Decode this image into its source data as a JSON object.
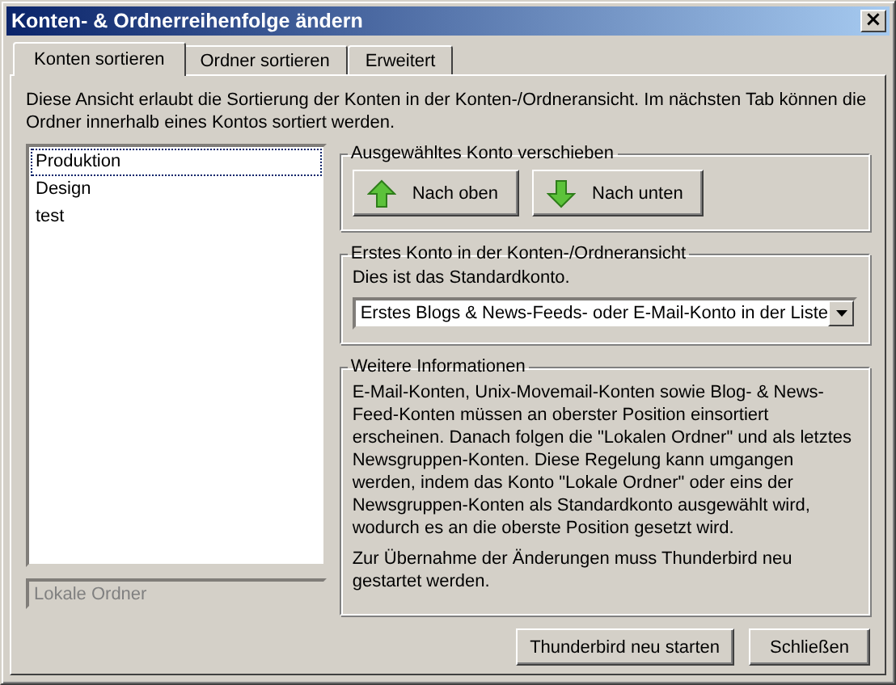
{
  "window": {
    "title": "Konten- & Ordnerreihenfolge ändern",
    "close": "×"
  },
  "tabs": [
    {
      "label": "Konten sortieren",
      "selected": true
    },
    {
      "label": "Ordner sortieren",
      "selected": false
    },
    {
      "label": "Erweitert",
      "selected": false
    }
  ],
  "description": "Diese Ansicht erlaubt die Sortierung der Konten in der Konten-/Ordneransicht. Im nächsten Tab können die Ordner innerhalb eines Kontos sortiert werden.",
  "accounts": [
    {
      "name": "Produktion",
      "focused": true
    },
    {
      "name": "Design",
      "focused": false
    },
    {
      "name": "test",
      "focused": false
    }
  ],
  "fixed_account": {
    "text": "Lokale Ordner",
    "disabled": true
  },
  "move_group": {
    "title": "Ausgewähltes Konto verschieben",
    "buttons": [
      {
        "label": "Nach oben",
        "kind": "up"
      },
      {
        "label": "Nach unten",
        "kind": "down"
      }
    ]
  },
  "first_account_group": {
    "title": "Erstes Konto in der Konten-/Ordneransicht",
    "note": "Dies ist das Standardkonto.",
    "dropdown": "Erstes Blogs & News-Feeds- oder E-Mail-Konto in der Liste"
  },
  "info_group": {
    "title": "Weitere Informationen",
    "paragraphs": [
      "E-Mail-Konten, Unix-Movemail-Konten sowie Blog- & News-Feed-Konten müssen an oberster Position einsortiert erscheinen. Danach folgen die \"Lokalen Ordner\" und als letztes Newsgruppen-Konten. Diese Regelung kann umgangen werden, indem das Konto \"Lokale Ordner\" oder eins der Newsgruppen-Konten als Standardkonto ausgewählt wird, wodurch es an die oberste Position gesetzt wird.",
      "Zur Übernahme der Änderungen muss Thunderbird neu gestartet werden."
    ]
  },
  "buttons": [
    "Thunderbird neu starten",
    "Schließen"
  ]
}
